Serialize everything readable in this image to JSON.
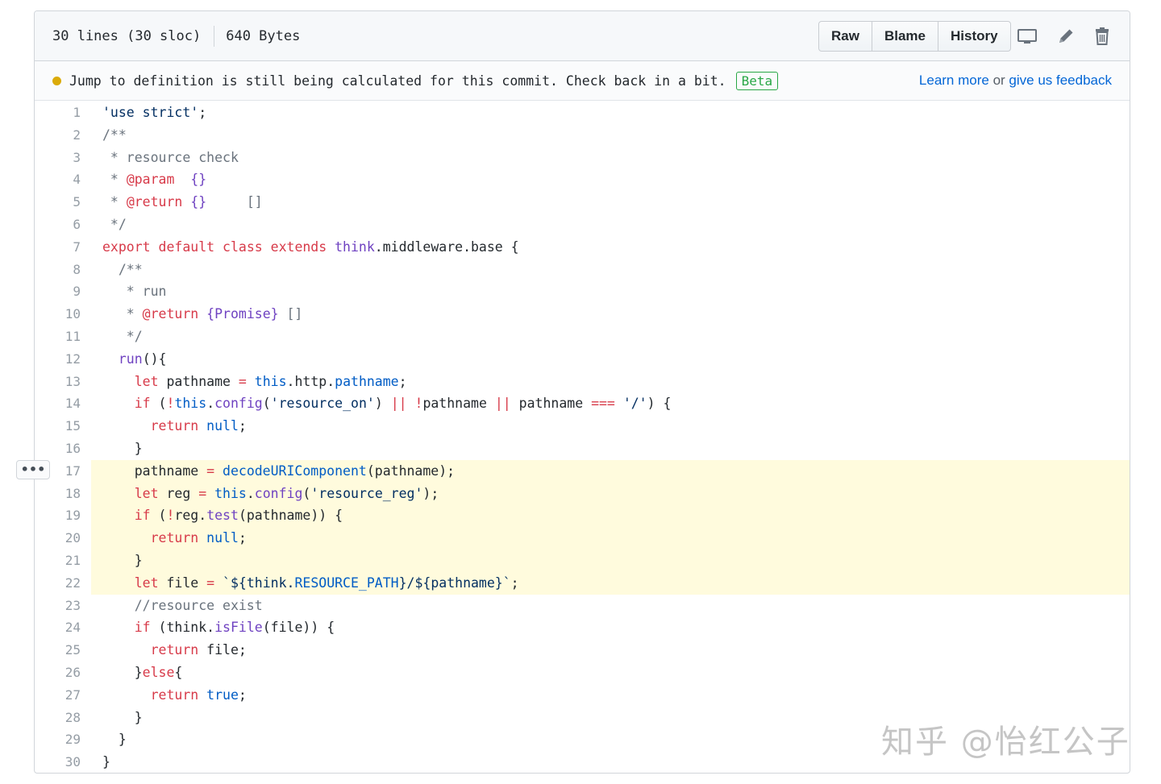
{
  "file_header": {
    "lines": "30 lines (30 sloc)",
    "size": "640 Bytes",
    "buttons": {
      "raw": "Raw",
      "blame": "Blame",
      "history": "History"
    },
    "icons": [
      "desktop-icon",
      "pencil-icon",
      "trash-icon"
    ]
  },
  "notice": {
    "message": "Jump to definition is still being calculated for this commit. Check back in a bit.",
    "badge": "Beta",
    "learn_more": "Learn more",
    "or": " or ",
    "feedback": "give us feedback"
  },
  "line_menu": {
    "label": "•••",
    "icon": "kebab-icon"
  },
  "colors": {
    "keyword": "#d73a49",
    "string": "#032f62",
    "comment": "#6a737d",
    "entity": "#6f42c1",
    "constant": "#005cc5",
    "highlight": "#fffbdd",
    "link": "#0366d6"
  },
  "code": {
    "highlighted_lines": [
      17,
      18,
      19,
      20,
      21,
      22
    ],
    "lines": [
      [
        [
          "str",
          "'use strict'"
        ],
        [
          "plain",
          ";"
        ]
      ],
      [
        [
          "cm",
          "/**"
        ]
      ],
      [
        [
          "cm",
          " * resource check"
        ]
      ],
      [
        [
          "cm",
          " * "
        ],
        [
          "kw",
          "@param"
        ],
        [
          "cm",
          "  "
        ],
        [
          "ent",
          "{}"
        ]
      ],
      [
        [
          "cm",
          " * "
        ],
        [
          "kw",
          "@return"
        ],
        [
          "cm",
          " "
        ],
        [
          "ent",
          "{}"
        ],
        [
          "cm",
          "     []"
        ]
      ],
      [
        [
          "cm",
          " */"
        ]
      ],
      [
        [
          "kw",
          "export"
        ],
        [
          "plain",
          " "
        ],
        [
          "kw",
          "default"
        ],
        [
          "plain",
          " "
        ],
        [
          "kw",
          "class"
        ],
        [
          "plain",
          " "
        ],
        [
          "kw",
          "extends"
        ],
        [
          "plain",
          " "
        ],
        [
          "ent",
          "think"
        ],
        [
          "plain",
          ".middleware.base {"
        ]
      ],
      [
        [
          "plain",
          "  "
        ],
        [
          "cm",
          "/**"
        ]
      ],
      [
        [
          "cm",
          "   * run"
        ]
      ],
      [
        [
          "cm",
          "   * "
        ],
        [
          "kw",
          "@return"
        ],
        [
          "cm",
          " "
        ],
        [
          "ent",
          "{Promise}"
        ],
        [
          "cm",
          " []"
        ]
      ],
      [
        [
          "cm",
          "   */"
        ]
      ],
      [
        [
          "plain",
          "  "
        ],
        [
          "ent",
          "run"
        ],
        [
          "plain",
          "(){"
        ]
      ],
      [
        [
          "plain",
          "    "
        ],
        [
          "kw",
          "let"
        ],
        [
          "plain",
          " pathname "
        ],
        [
          "kw",
          "="
        ],
        [
          "plain",
          " "
        ],
        [
          "const",
          "this"
        ],
        [
          "plain",
          ".http."
        ],
        [
          "const",
          "pathname"
        ],
        [
          "plain",
          ";"
        ]
      ],
      [
        [
          "plain",
          "    "
        ],
        [
          "kw",
          "if"
        ],
        [
          "plain",
          " ("
        ],
        [
          "kw",
          "!"
        ],
        [
          "const",
          "this"
        ],
        [
          "plain",
          "."
        ],
        [
          "ent",
          "config"
        ],
        [
          "plain",
          "("
        ],
        [
          "str",
          "'resource_on'"
        ],
        [
          "plain",
          ") "
        ],
        [
          "kw",
          "||"
        ],
        [
          "plain",
          " "
        ],
        [
          "kw",
          "!"
        ],
        [
          "plain",
          "pathname "
        ],
        [
          "kw",
          "||"
        ],
        [
          "plain",
          " pathname "
        ],
        [
          "kw",
          "==="
        ],
        [
          "plain",
          " "
        ],
        [
          "str",
          "'/'"
        ],
        [
          "plain",
          ") {"
        ]
      ],
      [
        [
          "plain",
          "      "
        ],
        [
          "kw",
          "return"
        ],
        [
          "plain",
          " "
        ],
        [
          "const",
          "null"
        ],
        [
          "plain",
          ";"
        ]
      ],
      [
        [
          "plain",
          "    }"
        ]
      ],
      [
        [
          "plain",
          "    pathname "
        ],
        [
          "kw",
          "="
        ],
        [
          "plain",
          " "
        ],
        [
          "const",
          "decodeURIComponent"
        ],
        [
          "plain",
          "(pathname);"
        ]
      ],
      [
        [
          "plain",
          "    "
        ],
        [
          "kw",
          "let"
        ],
        [
          "plain",
          " reg "
        ],
        [
          "kw",
          "="
        ],
        [
          "plain",
          " "
        ],
        [
          "const",
          "this"
        ],
        [
          "plain",
          "."
        ],
        [
          "ent",
          "config"
        ],
        [
          "plain",
          "("
        ],
        [
          "str",
          "'resource_reg'"
        ],
        [
          "plain",
          ");"
        ]
      ],
      [
        [
          "plain",
          "    "
        ],
        [
          "kw",
          "if"
        ],
        [
          "plain",
          " ("
        ],
        [
          "kw",
          "!"
        ],
        [
          "plain",
          "reg."
        ],
        [
          "ent",
          "test"
        ],
        [
          "plain",
          "(pathname)) {"
        ]
      ],
      [
        [
          "plain",
          "      "
        ],
        [
          "kw",
          "return"
        ],
        [
          "plain",
          " "
        ],
        [
          "const",
          "null"
        ],
        [
          "plain",
          ";"
        ]
      ],
      [
        [
          "plain",
          "    }"
        ]
      ],
      [
        [
          "plain",
          "    "
        ],
        [
          "kw",
          "let"
        ],
        [
          "plain",
          " file "
        ],
        [
          "kw",
          "="
        ],
        [
          "plain",
          " "
        ],
        [
          "str",
          "`${think."
        ],
        [
          "const",
          "RESOURCE_PATH"
        ],
        [
          "str",
          "}/${pathname}`"
        ],
        [
          "plain",
          ";"
        ]
      ],
      [
        [
          "cm",
          "    //resource exist"
        ]
      ],
      [
        [
          "plain",
          "    "
        ],
        [
          "kw",
          "if"
        ],
        [
          "plain",
          " (think."
        ],
        [
          "ent",
          "isFile"
        ],
        [
          "plain",
          "(file)) {"
        ]
      ],
      [
        [
          "plain",
          "      "
        ],
        [
          "kw",
          "return"
        ],
        [
          "plain",
          " file;"
        ]
      ],
      [
        [
          "plain",
          "    }"
        ],
        [
          "kw",
          "else"
        ],
        [
          "plain",
          "{"
        ]
      ],
      [
        [
          "plain",
          "      "
        ],
        [
          "kw",
          "return"
        ],
        [
          "plain",
          " "
        ],
        [
          "const",
          "true"
        ],
        [
          "plain",
          ";"
        ]
      ],
      [
        [
          "plain",
          "    }"
        ]
      ],
      [
        [
          "plain",
          "  }"
        ]
      ],
      [
        [
          "plain",
          "}"
        ]
      ]
    ]
  },
  "watermark": "知乎 @怡红公子"
}
